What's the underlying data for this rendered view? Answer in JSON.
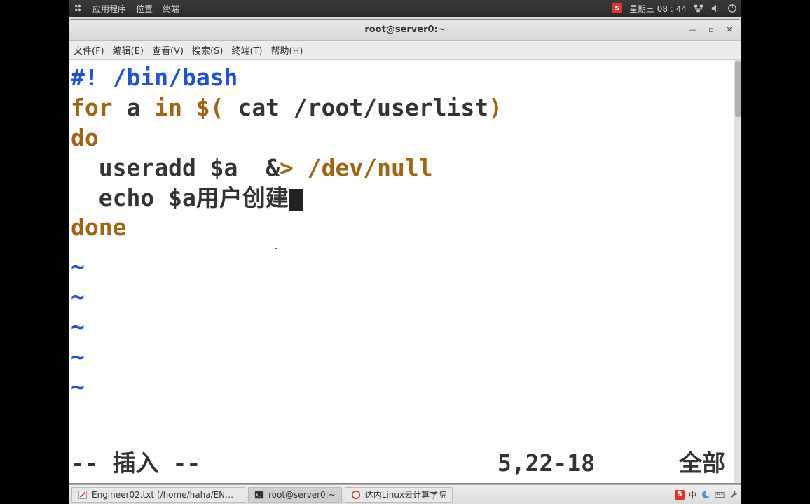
{
  "topbar": {
    "apps": "应用程序",
    "places": "位置",
    "terminal": "终端",
    "clock": "星期三 08 : 44"
  },
  "window": {
    "title": "root@server0:~",
    "menus": {
      "file": "文件(F)",
      "edit": "编辑(E)",
      "view": "查看(V)",
      "search": "搜索(S)",
      "terminal": "终端(T)",
      "help": "帮助(H)"
    }
  },
  "editor": {
    "lines": {
      "l1a": "#!",
      "l1b": " /bin/bash",
      "l2a": "for",
      "l2b": " a ",
      "l2c": "in",
      "l2d": " $(",
      "l2e": " cat /root/userlist",
      "l2f": ")",
      "l3": "do",
      "l4": "  useradd $a  &",
      "l4b": "> /dev/null",
      "l5": "  echo $a用户创建",
      "l6": "done"
    },
    "tilde": "~",
    "status_mode": "-- 插入 --",
    "status_pos": "5,22-18",
    "status_scope": "全部"
  },
  "taskbar": {
    "item1": "Engineer02.txt (/home/haha/ENGIN…",
    "item2": "root@server0:~",
    "item3": "达内Linux云计算学院",
    "ime": "中"
  }
}
